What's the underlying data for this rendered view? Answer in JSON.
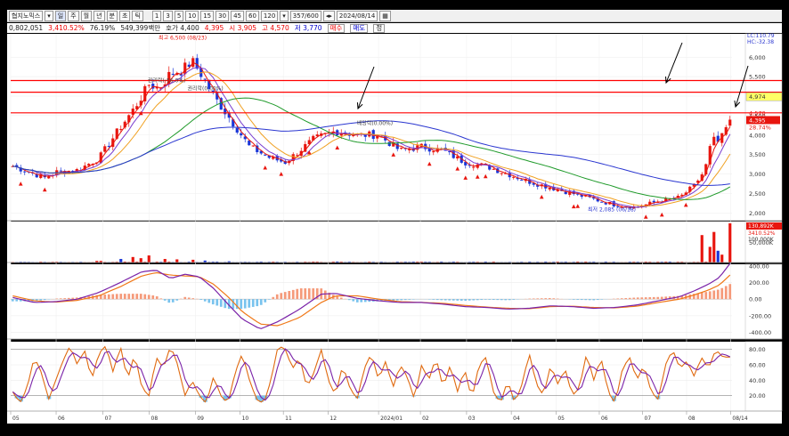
{
  "toolbar": {
    "name": "협지노믹스",
    "periods": [
      "주",
      "월",
      "년",
      "분",
      "초",
      "틱"
    ],
    "intervals": [
      "1",
      "3",
      "5",
      "10",
      "15",
      "30",
      "45",
      "60",
      "120"
    ],
    "count": "357/600",
    "date": "2024/08/14"
  },
  "infobar": {
    "volume_prefix": "0,802,051",
    "change": "3,410.52%",
    "ratio": "76.19%",
    "amount": "549,399백만",
    "quote": "호가 4,400",
    "close_value": "4,395",
    "open": "시 3,905",
    "high": "고 4,570",
    "low": "저 3,770",
    "buy_label": "매수",
    "sell_label": "매도",
    "extra_label": "정"
  },
  "colors": {
    "background": "#ffffff",
    "candle_up": "#e8150e",
    "candle_down": "#1a36d8",
    "ma5": "#e8150e",
    "ma10": "#7a3fd0",
    "ma20": "#f0a020",
    "ma60": "#1f9a2a",
    "ma120": "#2a36d0",
    "hline": "#ff0000",
    "macd_line": "#7a22a8",
    "signal_line": "#f07818",
    "osc_up": "#f59a7a",
    "osc_down": "#79c3ee",
    "stoch_k": "#e06a10",
    "stoch_d": "#7a22a8",
    "arrow": "#000000"
  },
  "chart_data": [
    {
      "type": "candlestick",
      "name": "price",
      "ylim": [
        1800,
        6600
      ],
      "yticks": [
        "6,000",
        "5,500",
        "5,000",
        "4,500",
        "4,000",
        "3,500",
        "3,000",
        "2,500",
        "2,000"
      ],
      "ytick_values": [
        6000,
        5500,
        5000,
        4500,
        4000,
        3500,
        3000,
        2500,
        2000
      ],
      "xticks": [
        "05",
        "06",
        "07",
        "08",
        "09",
        "10",
        "11",
        "12",
        "2024/01",
        "02",
        "03",
        "04",
        "05",
        "06",
        "07",
        "08",
        "08/14"
      ],
      "xtick_pos": [
        0.0,
        0.063,
        0.128,
        0.192,
        0.256,
        0.318,
        0.378,
        0.44,
        0.51,
        0.568,
        0.632,
        0.694,
        0.756,
        0.816,
        0.876,
        0.937,
        0.998
      ],
      "anchors": [
        [
          0,
          3200
        ],
        [
          0.03,
          3000
        ],
        [
          0.045,
          2900
        ],
        [
          0.06,
          3050
        ],
        [
          0.09,
          3100
        ],
        [
          0.12,
          3400
        ],
        [
          0.15,
          4200
        ],
        [
          0.17,
          4700
        ],
        [
          0.19,
          5300
        ],
        [
          0.205,
          5200
        ],
        [
          0.22,
          5600
        ],
        [
          0.235,
          5650
        ],
        [
          0.25,
          5900
        ],
        [
          0.265,
          5500
        ],
        [
          0.28,
          5000
        ],
        [
          0.3,
          4500
        ],
        [
          0.33,
          3700
        ],
        [
          0.36,
          3400
        ],
        [
          0.38,
          3300
        ],
        [
          0.4,
          3600
        ],
        [
          0.42,
          3900
        ],
        [
          0.45,
          4100
        ],
        [
          0.48,
          4000
        ],
        [
          0.51,
          4000
        ],
        [
          0.54,
          3600
        ],
        [
          0.57,
          3700
        ],
        [
          0.6,
          3600
        ],
        [
          0.63,
          3300
        ],
        [
          0.66,
          3200
        ],
        [
          0.69,
          3000
        ],
        [
          0.72,
          2800
        ],
        [
          0.75,
          2650
        ],
        [
          0.78,
          2500
        ],
        [
          0.81,
          2350
        ],
        [
          0.84,
          2200
        ],
        [
          0.87,
          2150
        ],
        [
          0.9,
          2300
        ],
        [
          0.93,
          2400
        ],
        [
          0.95,
          2700
        ],
        [
          0.965,
          3100
        ],
        [
          0.975,
          3900
        ],
        [
          0.985,
          3800
        ],
        [
          1.0,
          4395
        ]
      ],
      "ma_windows": [
        5,
        10,
        20,
        60,
        120
      ],
      "hlines": [
        5400,
        5100,
        4570
      ],
      "right_labels": {
        "top1": "LC:110.79",
        "top2": "HC:-32.38",
        "hline_tag": "4,974",
        "last_price": "4,395",
        "last_change": "28.74%",
        "near_hline": "4,570"
      },
      "annotations": [
        {
          "text": "최고 6,500 (08/23)",
          "color": "#e8150e",
          "t": 0.205,
          "v": 6500
        },
        {
          "text": "권리락(-56.0%)",
          "color": "#444444",
          "t": 0.19,
          "v": 5400
        },
        {
          "text": "권리락(0.00%)",
          "color": "#444444",
          "t": 0.245,
          "v": 5200
        },
        {
          "text": "배당락(0.00%)",
          "color": "#444444",
          "t": 0.48,
          "v": 4300
        },
        {
          "text": "최저 2,085 (06/18)",
          "color": "#2a36d0",
          "t": 0.8,
          "v": 2085
        }
      ],
      "markers_t": [
        0.012,
        0.045,
        0.18,
        0.35,
        0.375,
        0.415,
        0.455,
        0.53,
        0.58,
        0.62,
        0.63,
        0.65,
        0.66,
        0.74,
        0.78,
        0.79,
        0.885,
        0.905,
        0.94
      ]
    },
    {
      "type": "bar",
      "name": "volume",
      "ylim": [
        0,
        100000
      ],
      "ytick_label": "50,000K",
      "right_labels": {
        "v1": "130,892K",
        "v2": "3410.52%",
        "v3": "100,000K"
      },
      "base_volume": 1500,
      "spikes": [
        [
          0.12,
          4000
        ],
        [
          0.15,
          9000
        ],
        [
          0.17,
          14000
        ],
        [
          0.18,
          11000
        ],
        [
          0.19,
          18000
        ],
        [
          0.21,
          9000
        ],
        [
          0.23,
          8000
        ],
        [
          0.25,
          7000
        ],
        [
          0.27,
          5000
        ],
        [
          0.3,
          3000
        ],
        [
          0.45,
          2500
        ],
        [
          0.96,
          70000
        ],
        [
          0.97,
          90000
        ],
        [
          0.975,
          40000
        ],
        [
          0.98,
          78000
        ],
        [
          0.985,
          30000
        ],
        [
          0.99,
          20000
        ],
        [
          1.0,
          100000
        ]
      ]
    },
    {
      "type": "line",
      "name": "macd",
      "ylim": [
        -480,
        420
      ],
      "yticks": [
        "400.00",
        "200.00",
        "0.00",
        "-200.00",
        "-400.00"
      ],
      "ytick_values": [
        400,
        200,
        0,
        -200,
        -400
      ],
      "macd_anchors": [
        [
          0,
          20
        ],
        [
          0.03,
          -40
        ],
        [
          0.06,
          -30
        ],
        [
          0.09,
          0
        ],
        [
          0.12,
          80
        ],
        [
          0.15,
          200
        ],
        [
          0.18,
          330
        ],
        [
          0.2,
          350
        ],
        [
          0.22,
          250
        ],
        [
          0.24,
          300
        ],
        [
          0.26,
          270
        ],
        [
          0.28,
          130
        ],
        [
          0.3,
          -60
        ],
        [
          0.32,
          -240
        ],
        [
          0.345,
          -360
        ],
        [
          0.37,
          -270
        ],
        [
          0.4,
          -120
        ],
        [
          0.43,
          60
        ],
        [
          0.45,
          70
        ],
        [
          0.48,
          10
        ],
        [
          0.51,
          -20
        ],
        [
          0.54,
          -40
        ],
        [
          0.57,
          -40
        ],
        [
          0.6,
          -60
        ],
        [
          0.63,
          -90
        ],
        [
          0.66,
          -100
        ],
        [
          0.69,
          -120
        ],
        [
          0.72,
          -110
        ],
        [
          0.75,
          -80
        ],
        [
          0.78,
          -90
        ],
        [
          0.81,
          -110
        ],
        [
          0.84,
          -100
        ],
        [
          0.87,
          -70
        ],
        [
          0.9,
          -20
        ],
        [
          0.93,
          30
        ],
        [
          0.95,
          100
        ],
        [
          0.97,
          180
        ],
        [
          0.985,
          260
        ],
        [
          1.0,
          430
        ]
      ],
      "signal_anchors": [
        [
          0,
          40
        ],
        [
          0.03,
          -20
        ],
        [
          0.06,
          -35
        ],
        [
          0.09,
          -15
        ],
        [
          0.12,
          40
        ],
        [
          0.15,
          150
        ],
        [
          0.18,
          280
        ],
        [
          0.2,
          320
        ],
        [
          0.22,
          290
        ],
        [
          0.24,
          280
        ],
        [
          0.26,
          270
        ],
        [
          0.28,
          180
        ],
        [
          0.3,
          30
        ],
        [
          0.32,
          -150
        ],
        [
          0.345,
          -300
        ],
        [
          0.37,
          -320
        ],
        [
          0.4,
          -220
        ],
        [
          0.43,
          -40
        ],
        [
          0.45,
          40
        ],
        [
          0.48,
          40
        ],
        [
          0.51,
          0
        ],
        [
          0.54,
          -30
        ],
        [
          0.57,
          -40
        ],
        [
          0.6,
          -50
        ],
        [
          0.63,
          -75
        ],
        [
          0.66,
          -95
        ],
        [
          0.69,
          -110
        ],
        [
          0.72,
          -115
        ],
        [
          0.75,
          -90
        ],
        [
          0.78,
          -85
        ],
        [
          0.81,
          -100
        ],
        [
          0.84,
          -105
        ],
        [
          0.87,
          -85
        ],
        [
          0.9,
          -40
        ],
        [
          0.93,
          0
        ],
        [
          0.95,
          50
        ],
        [
          0.97,
          110
        ],
        [
          0.985,
          170
        ],
        [
          1.0,
          290
        ]
      ]
    },
    {
      "type": "line",
      "name": "stochastic",
      "ylim": [
        0,
        90
      ],
      "yticks": [
        "80.00",
        "60.00",
        "40.00",
        "20.00"
      ],
      "ytick_values": [
        80,
        60,
        40,
        20
      ],
      "upper_band": 80,
      "lower_band": 20,
      "k_anchors": [
        [
          0,
          25
        ],
        [
          0.01,
          10
        ],
        [
          0.02,
          30
        ],
        [
          0.03,
          70
        ],
        [
          0.04,
          50
        ],
        [
          0.05,
          15
        ],
        [
          0.06,
          40
        ],
        [
          0.07,
          65
        ],
        [
          0.08,
          85
        ],
        [
          0.09,
          60
        ],
        [
          0.1,
          80
        ],
        [
          0.11,
          40
        ],
        [
          0.12,
          75
        ],
        [
          0.13,
          85
        ],
        [
          0.14,
          50
        ],
        [
          0.15,
          85
        ],
        [
          0.16,
          40
        ],
        [
          0.17,
          75
        ],
        [
          0.18,
          30
        ],
        [
          0.19,
          20
        ],
        [
          0.2,
          70
        ],
        [
          0.21,
          55
        ],
        [
          0.22,
          85
        ],
        [
          0.23,
          60
        ],
        [
          0.24,
          20
        ],
        [
          0.25,
          40
        ],
        [
          0.26,
          20
        ],
        [
          0.27,
          10
        ],
        [
          0.28,
          45
        ],
        [
          0.29,
          20
        ],
        [
          0.3,
          10
        ],
        [
          0.31,
          50
        ],
        [
          0.32,
          75
        ],
        [
          0.33,
          40
        ],
        [
          0.34,
          15
        ],
        [
          0.35,
          10
        ],
        [
          0.36,
          40
        ],
        [
          0.37,
          85
        ],
        [
          0.38,
          80
        ],
        [
          0.39,
          55
        ],
        [
          0.4,
          70
        ],
        [
          0.41,
          30
        ],
        [
          0.42,
          50
        ],
        [
          0.43,
          80
        ],
        [
          0.44,
          40
        ],
        [
          0.45,
          20
        ],
        [
          0.46,
          60
        ],
        [
          0.47,
          30
        ],
        [
          0.48,
          15
        ],
        [
          0.49,
          55
        ],
        [
          0.5,
          75
        ],
        [
          0.51,
          40
        ],
        [
          0.52,
          65
        ],
        [
          0.53,
          30
        ],
        [
          0.54,
          60
        ],
        [
          0.55,
          45
        ],
        [
          0.56,
          15
        ],
        [
          0.57,
          60
        ],
        [
          0.58,
          40
        ],
        [
          0.59,
          70
        ],
        [
          0.6,
          30
        ],
        [
          0.61,
          60
        ],
        [
          0.62,
          25
        ],
        [
          0.63,
          55
        ],
        [
          0.64,
          15
        ],
        [
          0.65,
          60
        ],
        [
          0.66,
          70
        ],
        [
          0.67,
          25
        ],
        [
          0.68,
          10
        ],
        [
          0.69,
          40
        ],
        [
          0.7,
          10
        ],
        [
          0.71,
          35
        ],
        [
          0.72,
          75
        ],
        [
          0.73,
          35
        ],
        [
          0.74,
          20
        ],
        [
          0.75,
          60
        ],
        [
          0.76,
          35
        ],
        [
          0.77,
          55
        ],
        [
          0.78,
          20
        ],
        [
          0.79,
          30
        ],
        [
          0.8,
          75
        ],
        [
          0.81,
          40
        ],
        [
          0.82,
          70
        ],
        [
          0.83,
          25
        ],
        [
          0.84,
          10
        ],
        [
          0.85,
          55
        ],
        [
          0.86,
          70
        ],
        [
          0.87,
          40
        ],
        [
          0.88,
          60
        ],
        [
          0.89,
          25
        ],
        [
          0.9,
          15
        ],
        [
          0.91,
          60
        ],
        [
          0.92,
          80
        ],
        [
          0.93,
          55
        ],
        [
          0.94,
          65
        ],
        [
          0.95,
          45
        ],
        [
          0.96,
          70
        ],
        [
          0.97,
          55
        ],
        [
          0.98,
          80
        ],
        [
          0.99,
          70
        ],
        [
          1.0,
          70
        ]
      ]
    }
  ]
}
